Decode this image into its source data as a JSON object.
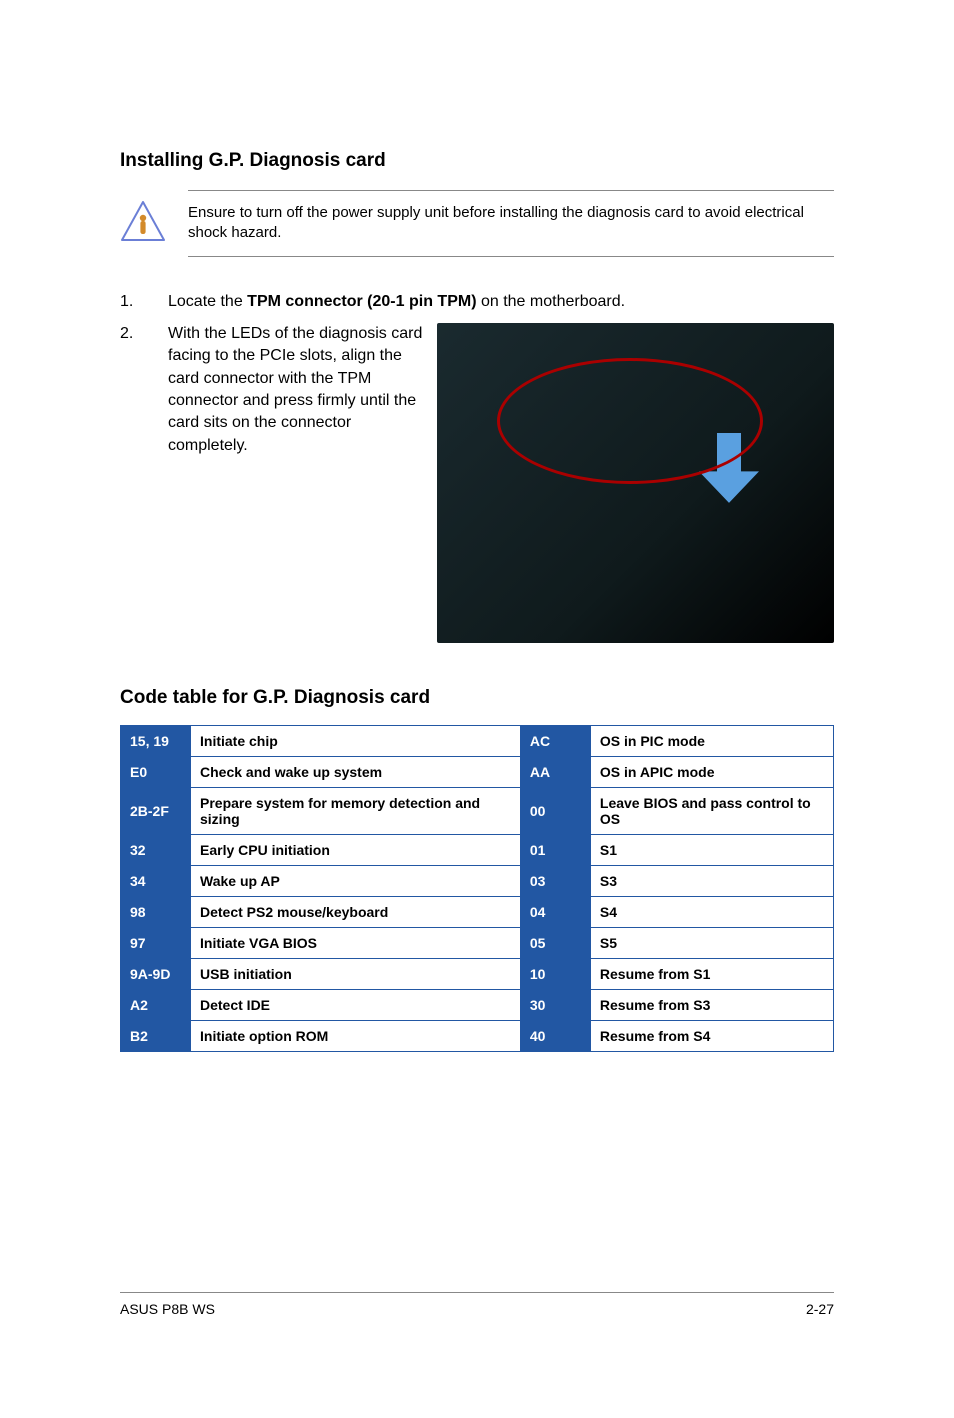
{
  "install_heading": "Installing G.P. Diagnosis card",
  "note_text": "Ensure to turn off the power supply unit before installing the diagnosis card to avoid electrical shock hazard.",
  "step1_pre": "Locate the ",
  "step1_bold": "TPM connector (20-1 pin TPM)",
  "step1_post": " on the motherboard.",
  "step2": "With the LEDs of the diagnosis card facing to the PCIe slots, align the card connector with the TPM connector and press firmly until the card sits on the connector completely.",
  "code_heading": "Code table for G.P. Diagnosis card",
  "rows": [
    {
      "c1": "15, 19",
      "d1": "Initiate chip",
      "c2": "AC",
      "d2": "OS in PIC mode"
    },
    {
      "c1": "E0",
      "d1": "Check and wake up system",
      "c2": "AA",
      "d2": "OS in APIC mode"
    },
    {
      "c1": "2B-2F",
      "d1": "Prepare system for memory detection and sizing",
      "c2": "00",
      "d2": "Leave BIOS and pass control to OS"
    },
    {
      "c1": "32",
      "d1": "Early CPU initiation",
      "c2": "01",
      "d2": "S1"
    },
    {
      "c1": "34",
      "d1": "Wake up AP",
      "c2": "03",
      "d2": "S3"
    },
    {
      "c1": "98",
      "d1": "Detect PS2 mouse/keyboard",
      "c2": "04",
      "d2": "S4"
    },
    {
      "c1": "97",
      "d1": "Initiate VGA BIOS",
      "c2": "05",
      "d2": "S5"
    },
    {
      "c1": "9A-9D",
      "d1": "USB initiation",
      "c2": "10",
      "d2": "Resume from S1"
    },
    {
      "c1": "A2",
      "d1": "Detect IDE",
      "c2": "30",
      "d2": "Resume from S3"
    },
    {
      "c1": "B2",
      "d1": "Initiate option ROM",
      "c2": "40",
      "d2": "Resume from S4"
    }
  ],
  "footer_left": "ASUS P8B WS",
  "footer_right": "2-27"
}
